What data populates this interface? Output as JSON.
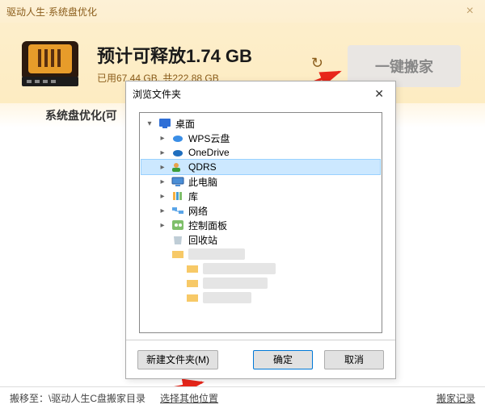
{
  "window": {
    "title": "驱动人生·系统盘优化"
  },
  "summary": {
    "title": "预计可释放1.74 GB",
    "sub": "已用67.44 GB, 共222.88 GB",
    "action": "一键搬家"
  },
  "context": {
    "label": "系统盘优化(可"
  },
  "dialog": {
    "title": "浏览文件夹",
    "new_folder": "新建文件夹(M)",
    "ok": "确定",
    "cancel": "取消",
    "tree": {
      "root": "桌面",
      "items": [
        {
          "label": "WPS云盘",
          "icon": "cloud"
        },
        {
          "label": "OneDrive",
          "icon": "cloud"
        },
        {
          "label": "QDRS",
          "icon": "user",
          "selected": true
        },
        {
          "label": "此电脑",
          "icon": "pc"
        },
        {
          "label": "库",
          "icon": "lib"
        },
        {
          "label": "网络",
          "icon": "net"
        },
        {
          "label": "控制面板",
          "icon": "ctrl"
        },
        {
          "label": "回收站",
          "icon": "bin"
        }
      ]
    }
  },
  "footer": {
    "move_to_prefix": "搬移至：",
    "move_to_path": "\\驱动人生C盘搬家目录",
    "choose_other": "选择其他位置",
    "history": "搬家记录"
  }
}
